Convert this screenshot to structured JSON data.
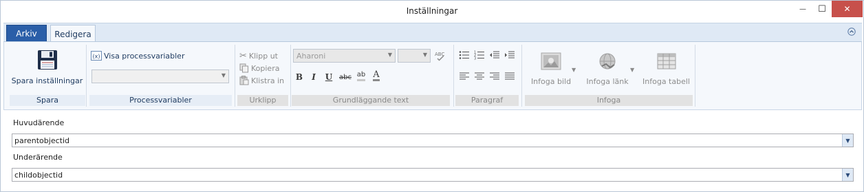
{
  "window": {
    "title": "Inställningar",
    "minimize_glyph": "—",
    "maximize_glyph": "☐",
    "close_glyph": "✕"
  },
  "tabs": {
    "arkiv": "Arkiv",
    "redigera": "Redigera"
  },
  "ribbon": {
    "spara": {
      "button_label": "Spara inställningar",
      "group_label": "Spara"
    },
    "processvariabler": {
      "toggle_label": "Visa processvariabler",
      "group_label": "Processvariabler"
    },
    "urklipp": {
      "cut": "Klipp ut",
      "copy": "Kopiera",
      "paste": "Klistra in",
      "group_label": "Urklipp"
    },
    "text": {
      "font_value": "Aharoni",
      "group_label": "Grundläggande text",
      "bold": "B",
      "italic": "I",
      "underline": "U",
      "strike": "abc",
      "highlight": "ab",
      "color": "A"
    },
    "paragraf": {
      "group_label": "Paragraf"
    },
    "infoga": {
      "image": "Infoga bild",
      "link": "Infoga länk",
      "table": "Infoga tabell",
      "group_label": "Infoga"
    }
  },
  "form": {
    "huvud_label": "Huvudärende",
    "huvud_value": "parentobjectid",
    "under_label": "Underärende",
    "under_value": "childobjectid"
  }
}
